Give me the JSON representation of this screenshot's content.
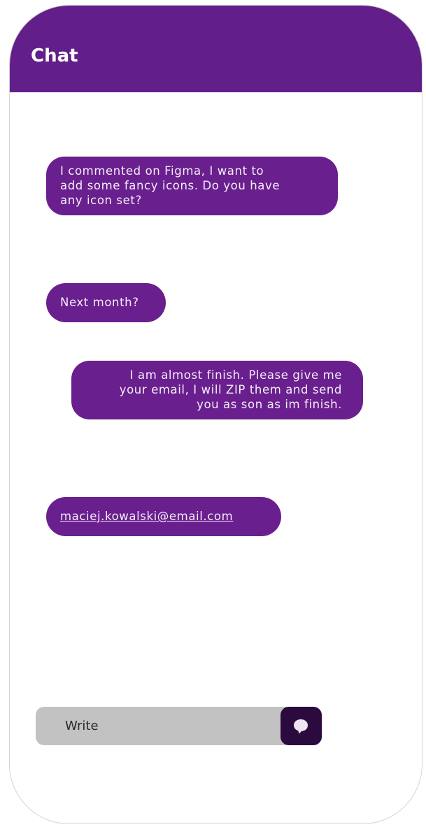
{
  "header": {
    "title": "Chat"
  },
  "messages": [
    {
      "text": "I commented on Figma, I want to\nadd some fancy icons. Do you have\nany icon set?",
      "side": "left"
    },
    {
      "text": "Next month?",
      "side": "left"
    },
    {
      "text": "I am almost finish. Please give me\nyour email, I will ZIP them and send\nyou as son as im finish.",
      "side": "right"
    },
    {
      "text": "maciej.kowalski@email.com",
      "side": "left",
      "link": true
    }
  ],
  "composer": {
    "placeholder": "Write",
    "send_icon": "chat-bubble-icon"
  },
  "colors": {
    "header": "#621F8A",
    "bubble": "#6A1F8E",
    "bubble_text": "#F4EEF7",
    "composer_bg": "#C2C2C2",
    "send_button": "#2B0A3D"
  }
}
